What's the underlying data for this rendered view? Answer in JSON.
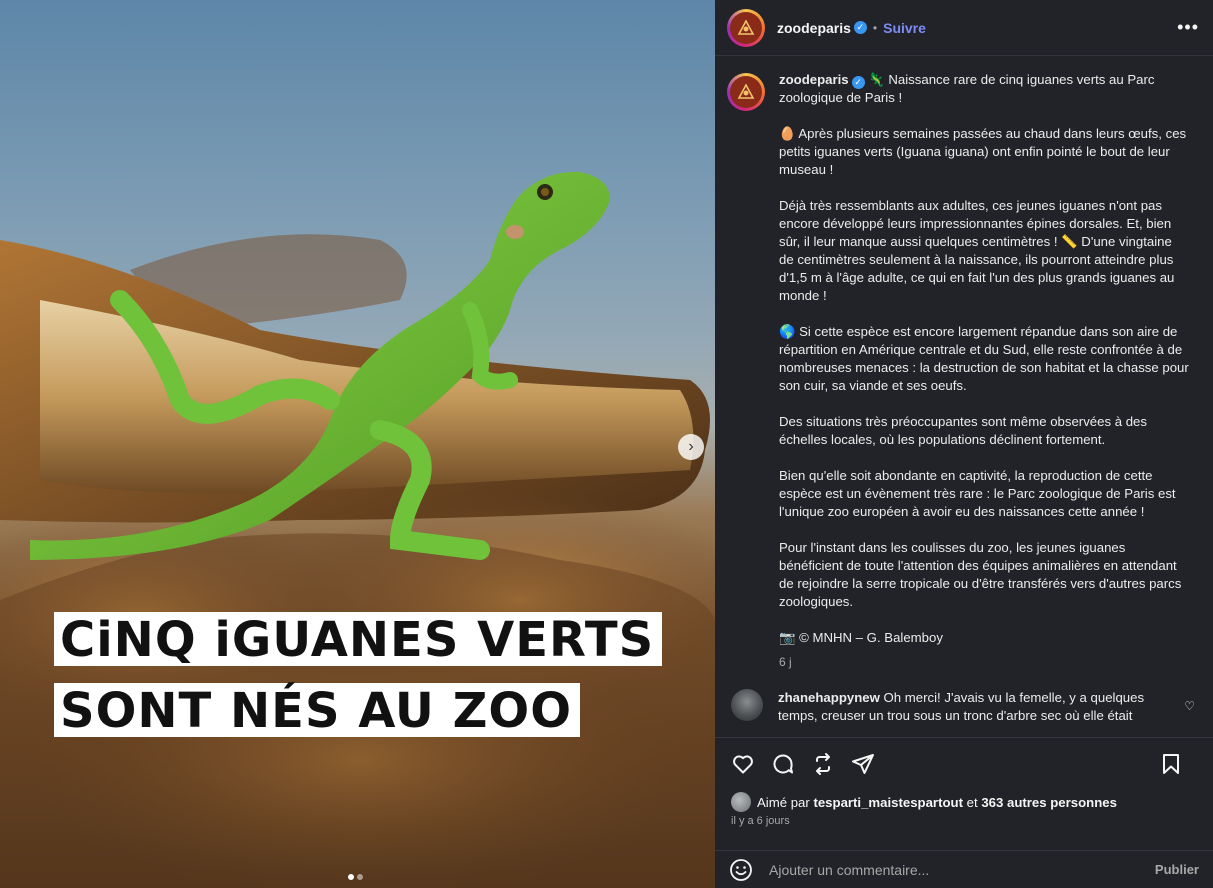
{
  "post": {
    "username": "zoodeparis",
    "follow_label": "Suivre",
    "more_label": "•••",
    "separator": "•"
  },
  "media": {
    "caption_line1": "CiNQ iGUANES VERTS",
    "caption_line2": "SONT NÉS AU ZOO",
    "next_icon": "›",
    "slide_count": 2,
    "current_slide": 1
  },
  "caption": {
    "p1": "🦎 Naissance rare de cinq iguanes verts au Parc zoologique de Paris !",
    "p2": "🥚 Après plusieurs semaines passées au chaud dans leurs œufs, ces petits iguanes verts (Iguana iguana) ont enfin pointé le bout de leur museau !",
    "p3": "Déjà très ressemblants aux adultes, ces jeunes iguanes n'ont pas encore développé leurs impressionnantes épines dorsales. Et, bien sûr, il leur manque aussi quelques centimètres ! 📏 D'une vingtaine de centimètres seulement à la naissance, ils pourront atteindre plus d'1,5 m à l'âge adulte, ce qui en fait l'un des plus grands iguanes au monde !",
    "p4": "🌎 Si cette espèce est encore largement répandue dans son aire de répartition en Amérique centrale et du Sud, elle reste confrontée à de nombreuses menaces : la destruction de son habitat et la chasse pour son cuir, sa viande et ses oeufs.",
    "p5": "Des situations très préoccupantes sont même observées à des échelles locales, où les populations déclinent fortement.",
    "p6": "Bien qu'elle soit abondante en captivité, la reproduction de cette espèce est un évènement très rare : le Parc zoologique de Paris est l'unique zoo européen à avoir eu des naissances cette année !",
    "p7": "Pour l'instant dans les coulisses du zoo, les jeunes iguanes bénéficient de toute l'attention des équipes animalières en attendant de rejoindre la serre tropicale ou d'être transférés vers d'autres parcs zoologiques.",
    "p8": "📷 © MNHN – G. Balemboy",
    "time": "6 j"
  },
  "comment": {
    "username": "zhanehappynew",
    "text": "Oh merci! J'avais vu la femelle, y a quelques temps, creuser un trou sous un tronc d'arbre sec où elle était"
  },
  "likes": {
    "prefix": "Aimé par",
    "user": "tesparti_maistespartout",
    "middle": "et",
    "others": "363 autres personnes"
  },
  "date": "il y a 6 jours",
  "comment_input": {
    "placeholder": "Ajouter un commentaire...",
    "publish_label": "Publier"
  },
  "icons": {
    "like": "heart-icon",
    "comment": "comment-icon",
    "repost": "repost-icon",
    "share": "share-icon",
    "save": "bookmark-icon",
    "emoji": "emoji-icon"
  },
  "colors": {
    "panel_bg": "#212328",
    "accent_link": "#7c8cf6",
    "verified": "#3897f0",
    "iguana_green": "#6fc23a"
  }
}
